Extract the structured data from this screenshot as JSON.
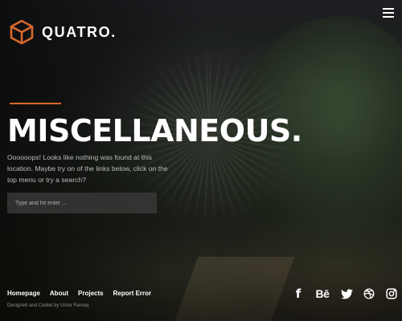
{
  "brand": {
    "name": "QUATRO.",
    "accent_color": "#d9692d"
  },
  "header": {
    "menu_icon": "hamburger-menu-icon"
  },
  "hero": {
    "title": "MISCELLANEOUS.",
    "description": "Oooooops! Looks like nothing was found at this location. Maybe try on of the links below, click on the top menu or try a search?"
  },
  "search": {
    "placeholder": "Type and hit enter ..."
  },
  "footer": {
    "links": [
      "Homepage",
      "About",
      "Projects",
      "Report Error"
    ],
    "credit": "Designed and Coded by Umar Farooq",
    "social_icons": [
      "facebook-icon",
      "behance-icon",
      "twitter-icon",
      "dribbble-icon",
      "instagram-icon"
    ],
    "behance_glyph": "Bē",
    "facebook_glyph": "f"
  }
}
